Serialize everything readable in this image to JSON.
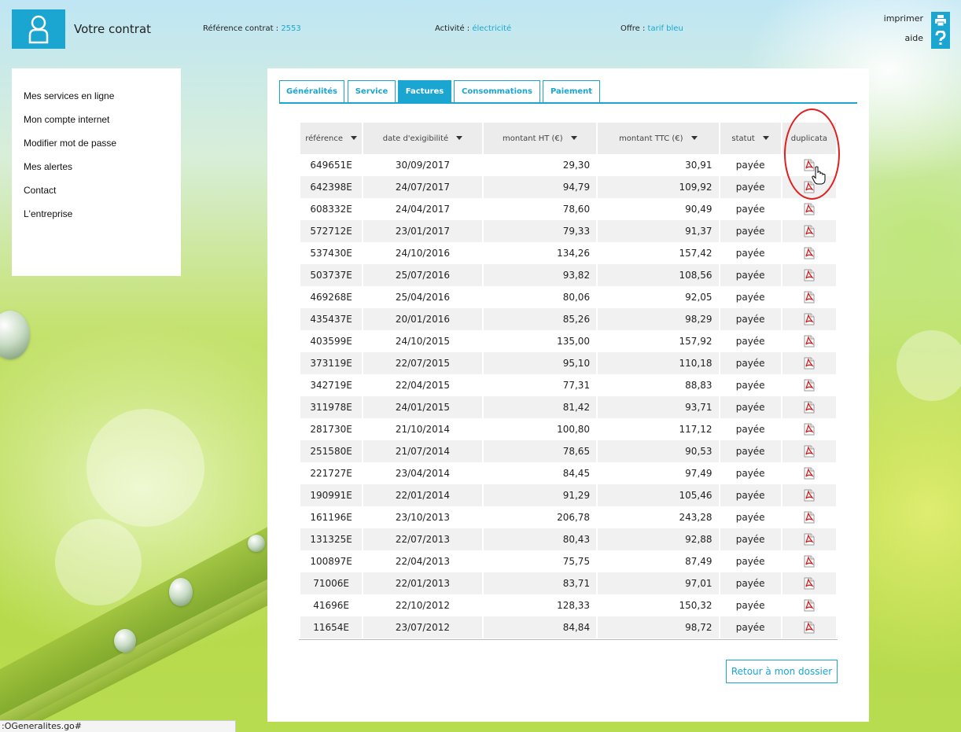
{
  "header": {
    "title": "Votre contrat",
    "ref_label": "Référence contrat :",
    "ref_value": "2553",
    "activity_label": "Activité :",
    "activity_value": "électricité",
    "offer_label": "Offre :",
    "offer_value": "tarif bleu",
    "print_label": "imprimer",
    "help_label": "aide"
  },
  "sidebar": {
    "items": [
      {
        "label": "Mes services en ligne"
      },
      {
        "label": "Mon compte internet"
      },
      {
        "label": "Modifier mot de passe"
      },
      {
        "label": "Mes alertes"
      },
      {
        "label": "Contact"
      },
      {
        "label": "L'entreprise"
      }
    ]
  },
  "tabs": [
    {
      "label": "Généralités",
      "active": false
    },
    {
      "label": "Service",
      "active": false
    },
    {
      "label": "Factures",
      "active": true
    },
    {
      "label": "Consommations",
      "active": false
    },
    {
      "label": "Paiement",
      "active": false
    }
  ],
  "table": {
    "columns": [
      "référence",
      "date d'exigibilité",
      "montant HT (€)",
      "montant TTC (€)",
      "statut",
      "duplicata"
    ],
    "rows": [
      [
        "649651E",
        "30/09/2017",
        "29,30",
        "30,91",
        "payée"
      ],
      [
        "642398E",
        "24/07/2017",
        "94,79",
        "109,92",
        "payée"
      ],
      [
        "608332E",
        "24/04/2017",
        "78,60",
        "90,49",
        "payée"
      ],
      [
        "572712E",
        "23/01/2017",
        "79,33",
        "91,37",
        "payée"
      ],
      [
        "537430E",
        "24/10/2016",
        "134,26",
        "157,42",
        "payée"
      ],
      [
        "503737E",
        "25/07/2016",
        "93,82",
        "108,56",
        "payée"
      ],
      [
        "469268E",
        "25/04/2016",
        "80,06",
        "92,05",
        "payée"
      ],
      [
        "435437E",
        "20/01/2016",
        "85,26",
        "98,29",
        "payée"
      ],
      [
        "403599E",
        "24/10/2015",
        "135,00",
        "157,92",
        "payée"
      ],
      [
        "373119E",
        "22/07/2015",
        "95,10",
        "110,18",
        "payée"
      ],
      [
        "342719E",
        "22/04/2015",
        "77,31",
        "88,83",
        "payée"
      ],
      [
        "311978E",
        "24/01/2015",
        "81,42",
        "93,71",
        "payée"
      ],
      [
        "281730E",
        "21/10/2014",
        "100,80",
        "117,12",
        "payée"
      ],
      [
        "251580E",
        "21/07/2014",
        "78,65",
        "90,53",
        "payée"
      ],
      [
        "221727E",
        "23/04/2014",
        "84,45",
        "97,49",
        "payée"
      ],
      [
        "190991E",
        "22/01/2014",
        "91,29",
        "105,46",
        "payée"
      ],
      [
        "161196E",
        "23/10/2013",
        "206,78",
        "243,28",
        "payée"
      ],
      [
        "131325E",
        "22/07/2013",
        "80,43",
        "92,88",
        "payée"
      ],
      [
        "100897E",
        "22/04/2013",
        "75,75",
        "87,49",
        "payée"
      ],
      [
        "71006E",
        "22/01/2013",
        "83,71",
        "97,01",
        "payée"
      ],
      [
        "41696E",
        "22/10/2012",
        "128,33",
        "150,32",
        "payée"
      ],
      [
        "11654E",
        "23/07/2012",
        "84,84",
        "98,72",
        "payée"
      ]
    ]
  },
  "back_button": "Retour à mon dossier",
  "status_bar": ":OGeneralites.go#",
  "icons": {
    "logo": "user-icon",
    "print": "printer-icon",
    "help": "question-icon",
    "duplicate": "pdf-icon",
    "sort": "sort-arrow-icon"
  },
  "colors": {
    "accent": "#1aa6d1",
    "highlight": "#e02020"
  }
}
